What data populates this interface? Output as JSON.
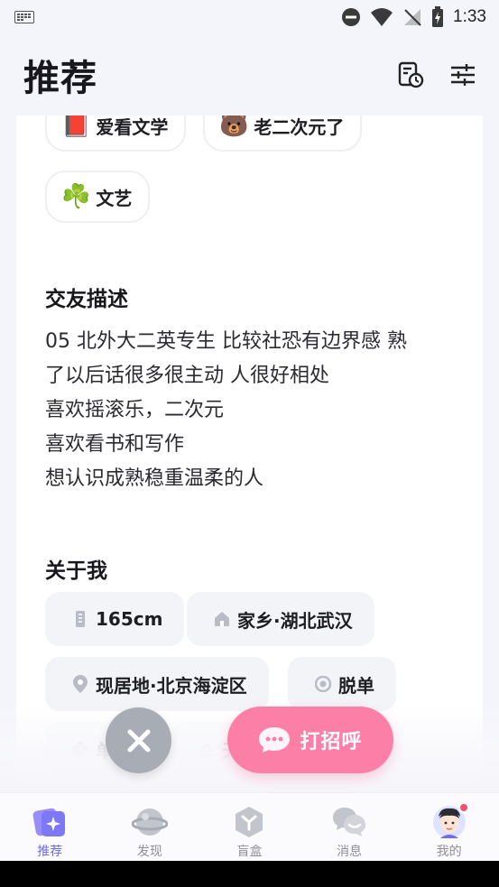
{
  "status_bar": {
    "time": "1:33"
  },
  "header": {
    "title": "推荐"
  },
  "tags": [
    {
      "emoji": "📕",
      "label": "爱看文学"
    },
    {
      "emoji": "🐻",
      "label": "老二次元了"
    },
    {
      "emoji": "☘️",
      "label": "文艺"
    }
  ],
  "sections": {
    "description_title": "交友描述",
    "about_title": "关于我"
  },
  "description_lines": [
    "05 北外大二英专生 比较社恐有边界感 熟",
    "了以后话很多很主动 人很好相处",
    "喜欢摇滚乐，二次元",
    "喜欢看书和写作",
    "想认识成熟稳重温柔的人"
  ],
  "about": {
    "height": "165cm",
    "hometown": "家乡·湖北武汉",
    "residence": "现居地·北京海淀区",
    "relationship": "脱单",
    "partial_1": "单",
    "partial_2": "天"
  },
  "actions": {
    "greet_label": "打招呼"
  },
  "tabs": [
    {
      "label": "推荐",
      "active": true
    },
    {
      "label": "发现"
    },
    {
      "label": "盲盒"
    },
    {
      "label": "消息"
    },
    {
      "label": "我的"
    }
  ],
  "colors": {
    "accent": "#6d6af3",
    "greet": "#fb7fa7",
    "dislike": "#a8acb5",
    "badge": "#fb4e6d"
  }
}
